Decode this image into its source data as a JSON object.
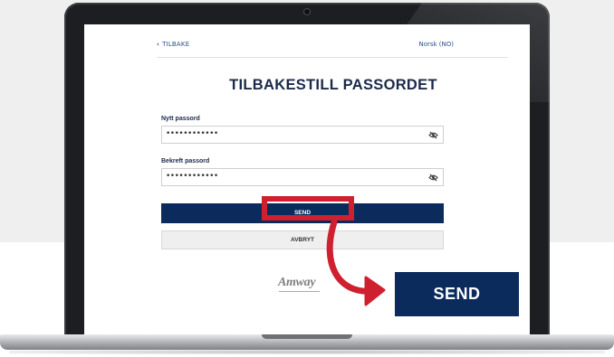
{
  "header": {
    "back_label": "TILBAKE",
    "language_label": "Norsk (NO)"
  },
  "page": {
    "title": "TILBAKESTILL PASSORDET"
  },
  "form": {
    "new_password_label": "Nytt passord",
    "new_password_value": "••••••••••••",
    "confirm_password_label": "Bekreft passord",
    "confirm_password_value": "••••••••••••",
    "send_label": "SEND",
    "cancel_label": "AVBRYT"
  },
  "brand": {
    "logo_text": "Amway"
  },
  "callout": {
    "send_label": "SEND"
  },
  "icons": {
    "back": "chevron-left-icon",
    "password_toggle": "eye-slash-icon"
  },
  "colors": {
    "primary": "#0a2b5c",
    "highlight": "#cf2030",
    "link": "#2c4f8a"
  }
}
